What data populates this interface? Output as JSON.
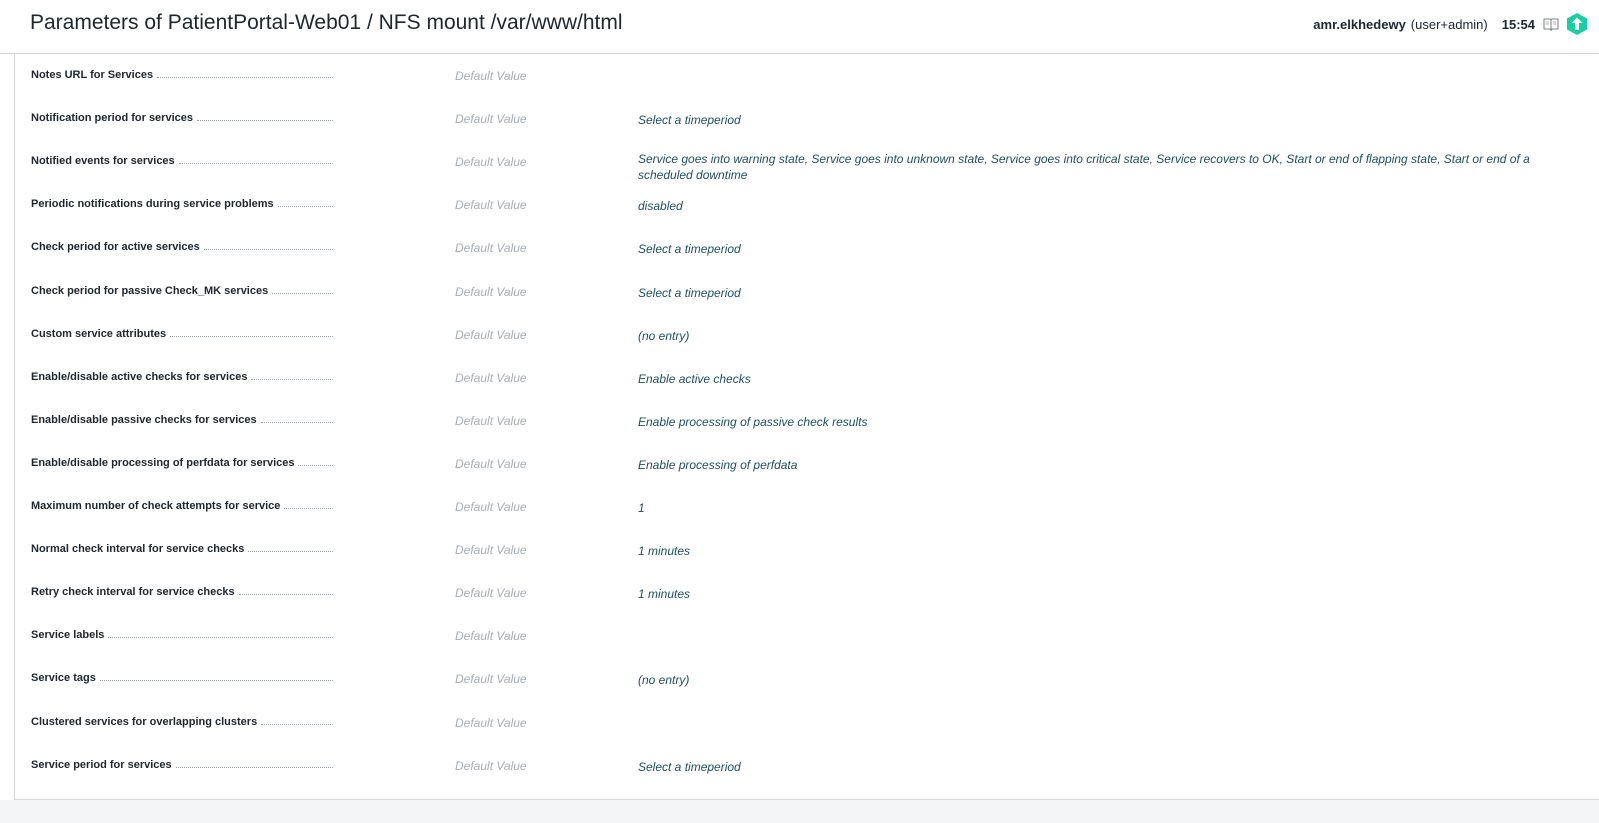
{
  "header": {
    "title": "Parameters of PatientPortal-Web01 / NFS mount /var/www/html",
    "username": "amr.elkhedewy",
    "role": "(user+admin)",
    "time": "15:54",
    "icons": {
      "help": "book-icon",
      "logo": "checkmk-logo-icon"
    },
    "accent_color": "#15d1a0"
  },
  "defaults_label": "Default Value",
  "parameters": [
    {
      "label": "Notes URL for Services",
      "default": "Default Value",
      "value": ""
    },
    {
      "label": "Notification period for services",
      "default": "Default Value",
      "value": "Select a timeperiod"
    },
    {
      "label": "Notified events for services",
      "default": "Default Value",
      "value": "Service goes into warning state, Service goes into unknown state, Service goes into critical state, Service recovers to OK, Start or end of flapping state, Start or end of a scheduled downtime"
    },
    {
      "label": "Periodic notifications during service problems",
      "default": "Default Value",
      "value": "disabled"
    },
    {
      "label": "Check period for active services",
      "default": "Default Value",
      "value": "Select a timeperiod"
    },
    {
      "label": "Check period for passive Check_MK services",
      "default": "Default Value",
      "value": "Select a timeperiod"
    },
    {
      "label": "Custom service attributes",
      "default": "Default Value",
      "value": "(no entry)"
    },
    {
      "label": "Enable/disable active checks for services",
      "default": "Default Value",
      "value": "Enable active checks"
    },
    {
      "label": "Enable/disable passive checks for services",
      "default": "Default Value",
      "value": "Enable processing of passive check results"
    },
    {
      "label": "Enable/disable processing of perfdata for services",
      "default": "Default Value",
      "value": "Enable processing of perfdata"
    },
    {
      "label": "Maximum number of check attempts for service",
      "default": "Default Value",
      "value": "1"
    },
    {
      "label": "Normal check interval for service checks",
      "default": "Default Value",
      "value": "1 minutes"
    },
    {
      "label": "Retry check interval for service checks",
      "default": "Default Value",
      "value": "1 minutes"
    },
    {
      "label": "Service labels",
      "default": "Default Value",
      "value": ""
    },
    {
      "label": "Service tags",
      "default": "Default Value",
      "value": "(no entry)"
    },
    {
      "label": "Clustered services for overlapping clusters",
      "default": "Default Value",
      "value": ""
    },
    {
      "label": "Service period for services",
      "default": "Default Value",
      "value": "Select a timeperiod"
    }
  ]
}
